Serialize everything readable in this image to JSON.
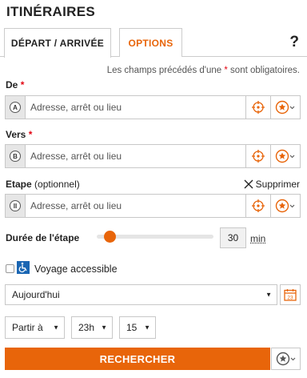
{
  "title": "ITINÉRAIRES",
  "tabs": [
    {
      "label": "DÉPART / ARRIVÉE",
      "active": true
    },
    {
      "label": "OPTIONS",
      "active": false
    }
  ],
  "help_label": "?",
  "mandatory_note": {
    "before": "Les champs précédés d'une ",
    "star": "*",
    "after": " sont obligatoires."
  },
  "fields": {
    "from": {
      "label": "De",
      "required_mark": "*",
      "badge": "A",
      "placeholder": "Adresse, arrêt ou lieu"
    },
    "to": {
      "label": "Vers",
      "required_mark": "*",
      "badge": "B",
      "placeholder": "Adresse, arrêt ou lieu"
    },
    "via": {
      "label": "Etape",
      "optional_note": "(optionnel)",
      "badge": "II",
      "placeholder": "Adresse, arrêt ou lieu",
      "delete_label": "Supprimer"
    }
  },
  "stop_duration": {
    "label": "Durée de l'étape",
    "value": "30",
    "unit": "min",
    "slider_fraction": 0.11
  },
  "accessible": {
    "label": "Voyage accessible",
    "checked": false
  },
  "date": {
    "selected": "Aujourd'hui"
  },
  "time": {
    "mode": "Partir à",
    "hour": "23h",
    "minute": "15"
  },
  "search_label": "RECHERCHER",
  "colors": {
    "accent": "#e8650a",
    "required": "#e30613",
    "accessible_blue": "#1a66b3"
  },
  "icons": {
    "locate": "crosshair-icon",
    "favorite": "star-icon",
    "calendar": "calendar-icon",
    "delete": "close-icon",
    "accessible": "wheelchair-icon"
  }
}
